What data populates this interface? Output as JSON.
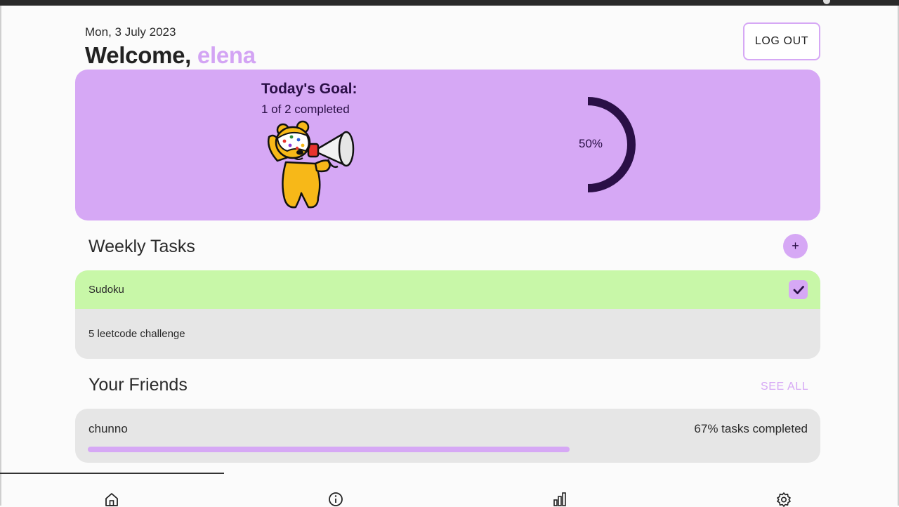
{
  "header": {
    "date": "Mon, 3 July 2023",
    "welcome_prefix": "Welcome, ",
    "username": "elena",
    "logout_label": "LOG OUT"
  },
  "goal": {
    "title": "Today's Goal:",
    "progress_text": "1 of 2 completed",
    "percent_label": "50%",
    "percent_value": 50
  },
  "weekly_tasks": {
    "title": "Weekly Tasks",
    "add_label": "+",
    "items": [
      {
        "label": "Sudoku",
        "completed": true
      },
      {
        "label": "5 leetcode challenge",
        "completed": false
      }
    ]
  },
  "friends": {
    "title": "Your Friends",
    "see_all_label": "SEE ALL",
    "items": [
      {
        "name": "chunno",
        "progress_text": "67% tasks completed",
        "progress_value": 67
      }
    ]
  },
  "nav": {
    "icons": [
      "home-icon",
      "info-icon",
      "stats-icon",
      "settings-icon"
    ]
  },
  "colors": {
    "accent": "#d6a8f5",
    "completed_task": "#c8f7a8",
    "dark_purple": "#2a0f46"
  }
}
